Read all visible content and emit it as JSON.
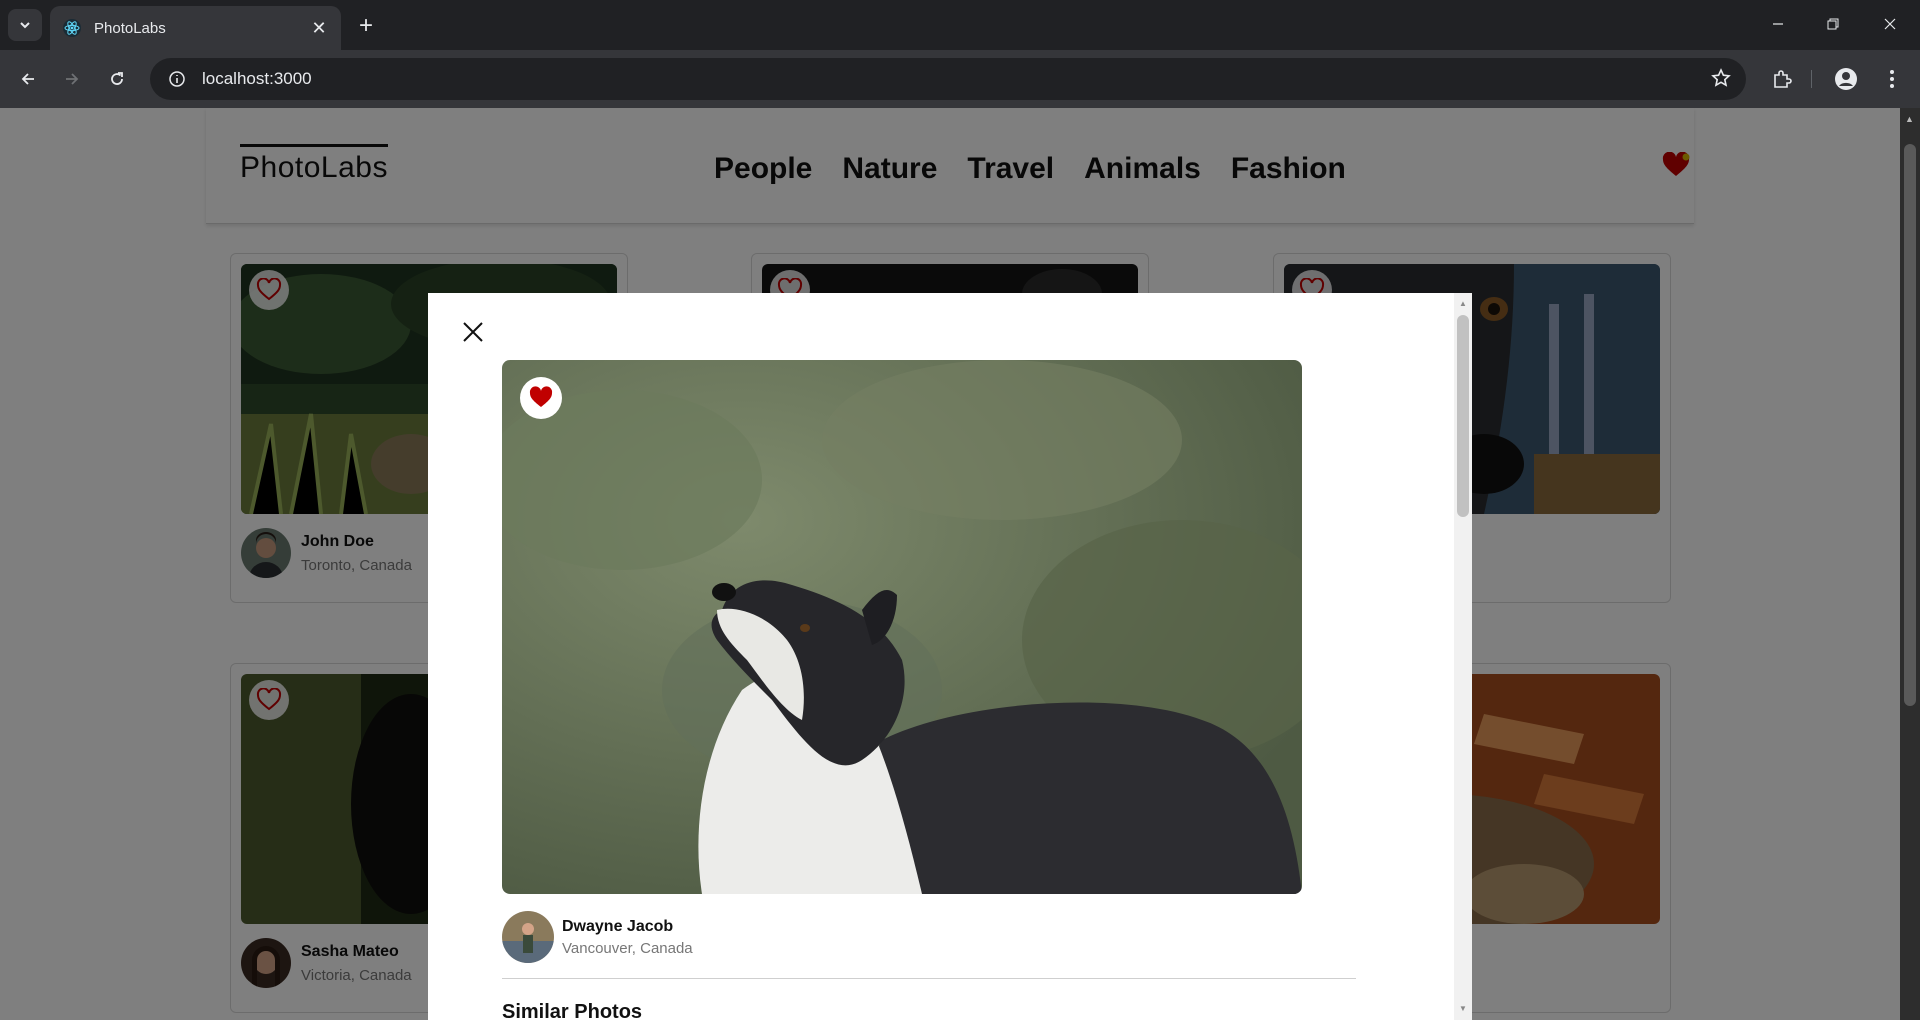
{
  "browser": {
    "tab_title": "PhotoLabs",
    "url": "localhost:3000"
  },
  "app": {
    "logo": "PhotoLabs",
    "topics": [
      "People",
      "Nature",
      "Travel",
      "Animals",
      "Fashion"
    ],
    "fav_badge_has_items": true
  },
  "cards": [
    {
      "user_name": "John Doe",
      "location": "Toronto, Canada",
      "favourited": false
    },
    {
      "user_name": "",
      "location": "",
      "favourited": false
    },
    {
      "user_name": "",
      "location": "",
      "favourited": false
    },
    {
      "user_name": "Sasha Mateo",
      "location": "Victoria, Canada",
      "favourited": false
    },
    {
      "user_name": "",
      "location": "",
      "favourited": false
    },
    {
      "user_name": "",
      "location": "",
      "favourited": false
    }
  ],
  "modal": {
    "user_name": "Dwayne Jacob",
    "location": "Vancouver, Canada",
    "favourited": true,
    "similar_heading": "Similar Photos"
  },
  "colors": {
    "heart_red": "#c00000",
    "overlay": "rgba(0,0,0,0.5)"
  }
}
